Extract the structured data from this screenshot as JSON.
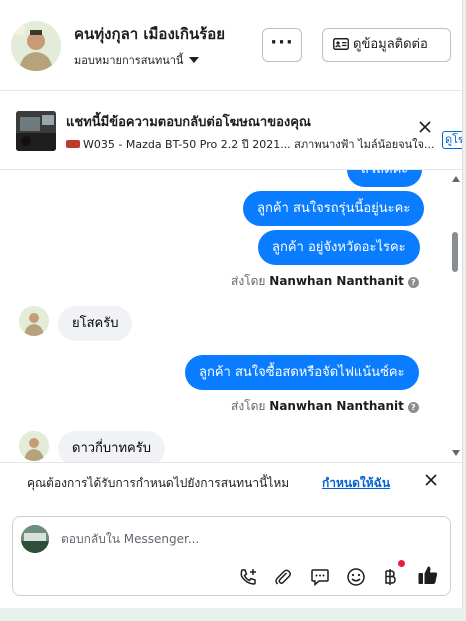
{
  "header": {
    "name": "คนทุ่งกุลา เมืองเกินร้อย",
    "assign_label": "มอบหมายการสนทนานี้",
    "more_label": "···",
    "contact_label": "ดูข้อมูลติดต่อ"
  },
  "ad": {
    "title": "แชทนี้มีข้อความตอบกลับต่อโฆษณาของคุณ",
    "subtitle": "W035 - Mazda BT-50 Pro 2.2 ปี 2021... สภาพนางฟ้า ไมล์น้อยจนใจ...",
    "link_label": "ดูโฆษณา"
  },
  "messages": {
    "partial_label": "สวัสดีค่ะ",
    "out_1": "ลูกค้า สนใจรถรุ่นนี้อยู่นะคะ",
    "out_2": "ลูกค้า อยู่จังหวัดอะไรคะ",
    "sent_by_prefix": "ส่งโดย",
    "sent_by_name": "Nanwhan Nanthanit",
    "in_1": "ยโสครับ",
    "out_3": "ลูกค้า สนใจซื้อสดหรือจัดไฟแน้นซ์คะ",
    "in_2": "ดาวกี่บาทครับ"
  },
  "schedule": {
    "question": "คุณต้องการได้รับการกำหนดไปยังการสนทนานี้ไหม",
    "action": "กำหนดให้ฉัน"
  },
  "composer": {
    "placeholder": "ตอบกลับใน Messenger..."
  },
  "colors": {
    "accent": "#0a7cff",
    "link": "#0064d1",
    "badge": "#e41e3f"
  }
}
